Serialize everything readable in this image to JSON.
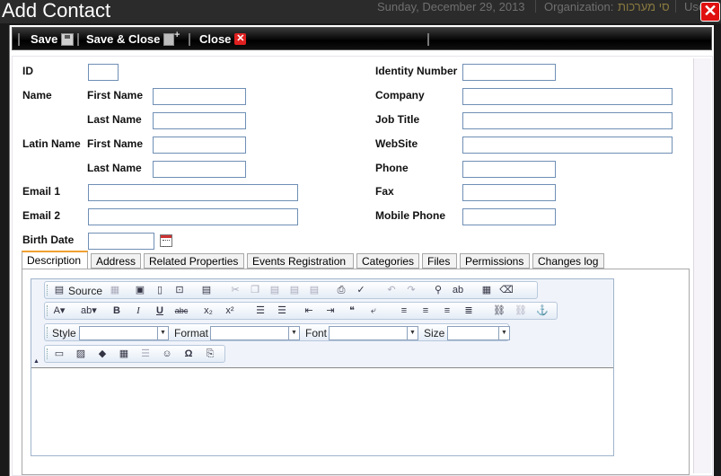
{
  "background": {
    "date": "Sunday, December 29, 2013",
    "organization_label": "Organization:",
    "organization_value": "סי מערכות",
    "user_label": "Use"
  },
  "window": {
    "title": "Add Contact",
    "close_symbol": "✕"
  },
  "toolbar": {
    "save_label": "Save",
    "save_close_label": "Save & Close",
    "close_label": "Close"
  },
  "form": {
    "id_label": "ID",
    "name_label": "Name",
    "first_name_label": "First Name",
    "last_name_label": "Last Name",
    "latin_name_label": "Latin Name",
    "latin_first_name_label": "First Name",
    "latin_last_name_label": "Last Name",
    "email1_label": "Email 1",
    "email2_label": "Email 2",
    "birth_date_label": "Birth Date",
    "identity_number_label": "Identity Number",
    "company_label": "Company",
    "job_title_label": "Job Title",
    "website_label": "WebSite",
    "phone_label": "Phone",
    "fax_label": "Fax",
    "mobile_phone_label": "Mobile Phone"
  },
  "tabs": [
    "Description",
    "Address",
    "Related Properties",
    "Events Registration",
    "Categories",
    "Files",
    "Permissions",
    "Changes log"
  ],
  "active_tab": "Description",
  "editor": {
    "source_label": "Source",
    "style_label": "Style",
    "format_label": "Format",
    "font_label": "Font",
    "size_label": "Size",
    "style_value": "",
    "format_value": "",
    "font_value": "",
    "size_value": "",
    "content": ""
  },
  "colors": {
    "accent_tab": "#f0a030",
    "close_red": "#e01010",
    "input_border": "#6f8fb5"
  }
}
